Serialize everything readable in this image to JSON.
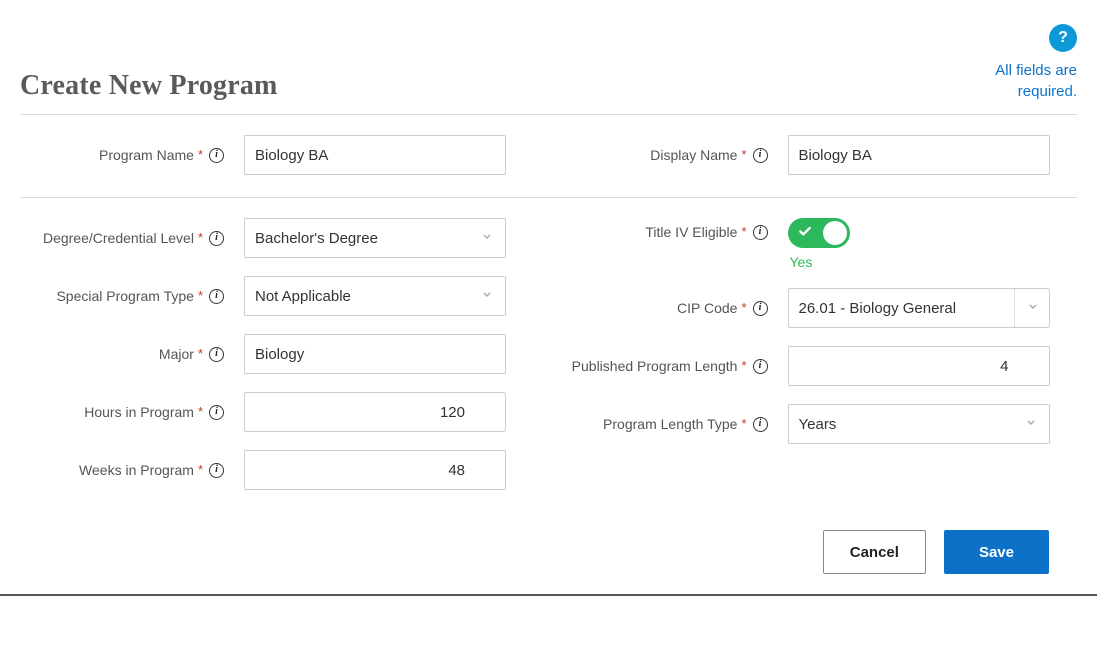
{
  "help_badge": "?",
  "page_title": "Create New Program",
  "required_note_l1": "All fields are",
  "required_note_l2": "required.",
  "labels": {
    "program_name": "Program Name",
    "display_name": "Display Name",
    "degree_level": "Degree/Credential Level",
    "title_iv": "Title IV Eligible",
    "special_type": "Special Program Type",
    "cip_code": "CIP Code",
    "major": "Major",
    "pub_length": "Published Program Length",
    "hours": "Hours in Program",
    "length_type": "Program Length Type",
    "weeks": "Weeks in Program"
  },
  "values": {
    "program_name": "Biology BA",
    "display_name": "Biology BA",
    "degree_level": "Bachelor's Degree",
    "title_iv_state": "Yes",
    "special_type": "Not Applicable",
    "cip_code": "26.01 - Biology General",
    "major": "Biology",
    "pub_length": "4",
    "hours": "120",
    "length_type": "Years",
    "weeks": "48"
  },
  "required_marker": "*",
  "info_glyph": "i",
  "buttons": {
    "cancel": "Cancel",
    "save": "Save"
  }
}
